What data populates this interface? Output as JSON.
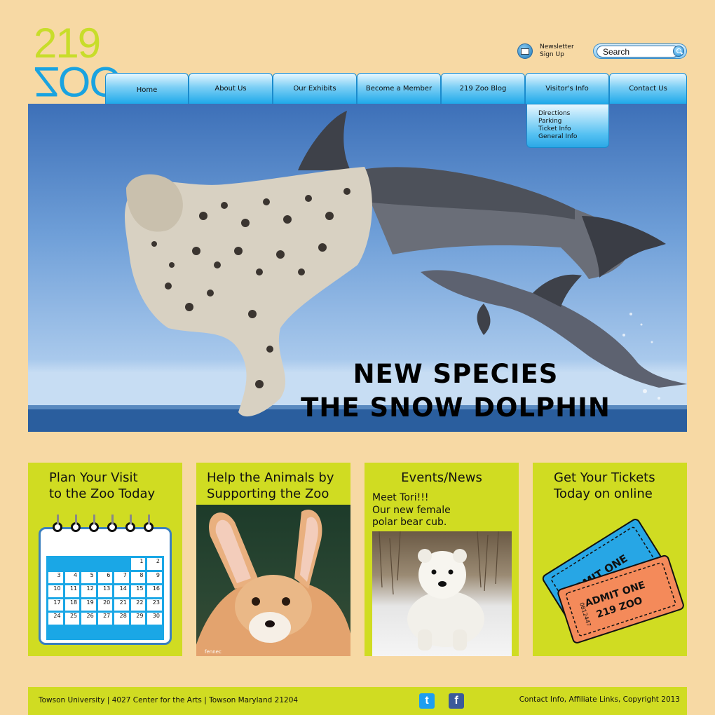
{
  "logo": {
    "top": "219",
    "bottom": "ZOO"
  },
  "newsletter": {
    "label": "Newsletter Sign Up",
    "icon": "envelope-icon"
  },
  "search": {
    "placeholder": "Search",
    "value": "Search"
  },
  "nav": {
    "tabs": [
      "Home",
      "About Us",
      "Our Exhibits",
      "Become a Member",
      "219 Zoo Blog",
      "Visitor's Info",
      "Contact Us"
    ],
    "dropdown": [
      "Directions",
      "Parking",
      "Ticket Info",
      "General Info"
    ]
  },
  "hero": {
    "line1": "NEW SPECIES",
    "line2": "THE SNOW DOLPHIN"
  },
  "cards": [
    {
      "title_line1": "Plan Your Visit",
      "title_line2": "to the Zoo Today"
    },
    {
      "title_line1": "Help the Animals by",
      "title_line2": "Supporting the Zoo",
      "photo_caption": "fennec"
    },
    {
      "title": "Events/News",
      "text_line1": "Meet Tori!!!",
      "text_line2": "Our new female",
      "text_line3": "polar bear cub."
    },
    {
      "title_line1": "Get Your  Tickets",
      "title_line2": "Today on online",
      "ticket1": "ADMIT ONE",
      "ticket2": "219 ZOO",
      "ticket_number": "0812447"
    }
  ],
  "calendar": {
    "days": [
      "",
      "",
      "",
      "",
      "",
      "1",
      "2",
      "3",
      "4",
      "5",
      "6",
      "7",
      "8",
      "9",
      "10",
      "11",
      "12",
      "13",
      "14",
      "15",
      "16",
      "17",
      "18",
      "19",
      "20",
      "21",
      "22",
      "23",
      "24",
      "25",
      "26",
      "27",
      "28",
      "29",
      "30"
    ]
  },
  "footer": {
    "address": "Towson University | 4027 Center for the Arts | Towson Maryland 21204",
    "links": "Contact Info, Affiliate Links, Copyright 2013",
    "twitter_icon": "t",
    "facebook_icon": "f"
  },
  "colors": {
    "background": "#f7d9a4",
    "card": "#d0dc22",
    "accent_blue": "#1aa3e0",
    "logo_green": "#c8dd2a"
  }
}
